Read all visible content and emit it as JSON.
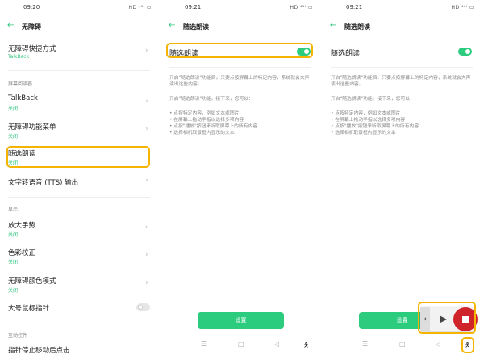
{
  "panel1": {
    "time": "09:20",
    "status": "HD ⁴⁶ᴵ ▭",
    "title": "无障碍",
    "shortcut": {
      "label": "无障碍快捷方式",
      "sub": "TalkBack"
    },
    "section_reader": "屏幕阅读器",
    "talkback": {
      "label": "TalkBack",
      "sub": "关闭"
    },
    "menu": {
      "label": "无障碍功能菜单",
      "sub": "关闭"
    },
    "select": {
      "label": "随选朗读",
      "sub": "关闭"
    },
    "tts": {
      "label": "文字转语音 (TTS) 输出"
    },
    "section_display": "显示",
    "magnify": {
      "label": "放大手势",
      "sub": "关闭"
    },
    "color": {
      "label": "色彩校正",
      "sub": "关闭"
    },
    "colormode": {
      "label": "无障碍颜色模式",
      "sub": "关闭"
    },
    "pointer": {
      "label": "大号鼠标指针",
      "on": false
    },
    "section_interact": "互动控件",
    "dwell": {
      "label": "指针停止移动后点击"
    }
  },
  "panel2": {
    "time": "09:21",
    "status": "HD ⁴⁶ᴵ ▭",
    "title": "随选朗读",
    "toggle_label": "随选朗读",
    "toggle_on": true,
    "desc1": "开启\"随选朗读\"功能后，只要点按屏幕上的特定内容，系统就会大声读出这些内容。",
    "desc2": "开启\"随选朗读\"功能。接下来，您可以：",
    "bullets": [
      "• 点按特定内容，例如文本或图片",
      "• 在屏幕上拖动手指以选择多项内容",
      "• 点按\"播放\"按钮来听取屏幕上的所有内容",
      "• 选择相机取景框内显示的文本"
    ],
    "button": "设置"
  },
  "panel3": {
    "time": "09:21",
    "status": "HD ⁴⁶ᴵ ▭",
    "title": "随选朗读",
    "toggle_label": "随选朗读",
    "toggle_on": true,
    "button": "设置"
  },
  "colors": {
    "accent": "#2ccc7f",
    "highlight": "#f5b400",
    "stop": "#d0242b"
  }
}
